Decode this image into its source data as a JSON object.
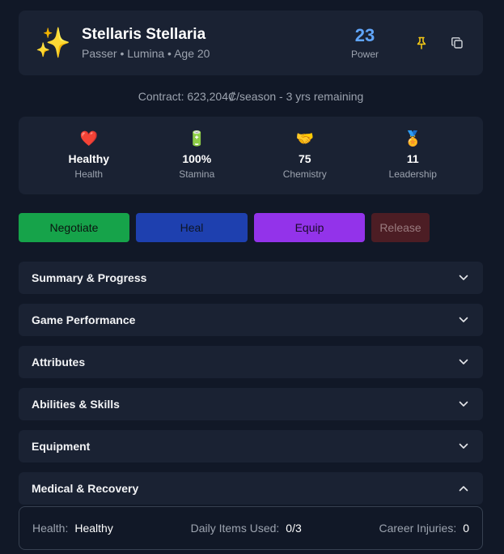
{
  "player": {
    "avatar": "✨",
    "name": "Stellaris Stellaria",
    "meta": "Passer • Lumina • Age 20",
    "power_value": "23",
    "power_label": "Power"
  },
  "icons": {
    "pin": "pin-icon",
    "copy": "copy-icon",
    "chevron_down": "chevron-down-icon",
    "chevron_up": "chevron-up-icon"
  },
  "contract": "Contract: 623,204₡/season - 3 yrs remaining",
  "stats": [
    {
      "icon": "❤️",
      "value": "Healthy",
      "label": "Health"
    },
    {
      "icon": "🔋",
      "value": "100%",
      "label": "Stamina"
    },
    {
      "icon": "🤝",
      "value": "75",
      "label": "Chemistry"
    },
    {
      "icon": "🏅",
      "value": "11",
      "label": "Leadership"
    }
  ],
  "actions": {
    "negotiate": "Negotiate",
    "heal": "Heal",
    "equip": "Equip",
    "release": "Release"
  },
  "sections": [
    "Summary & Progress",
    "Game Performance",
    "Attributes",
    "Abilities & Skills",
    "Equipment",
    "Medical & Recovery"
  ],
  "medical": {
    "health_label": "Health:",
    "health_value": "Healthy",
    "items_label": "Daily Items Used:",
    "items_value": "0/3",
    "injuries_label": "Career Injuries:",
    "injuries_value": "0"
  },
  "colors": {
    "accent_power": "#60a5fa",
    "pin": "#facc15",
    "negotiate": "#16a34a",
    "heal": "#1e40af",
    "equip": "#9333ea",
    "release": "#4c1d24"
  }
}
